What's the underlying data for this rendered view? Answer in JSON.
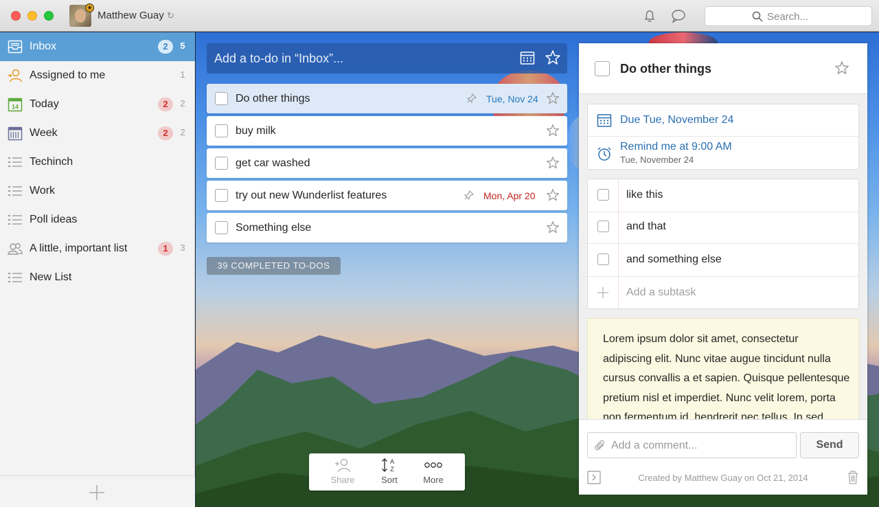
{
  "titlebar": {
    "username": "Matthew Guay",
    "search_placeholder": "Search..."
  },
  "sidebar": {
    "items": [
      {
        "label": "Inbox",
        "overdue": "2",
        "count": "5",
        "icon": "inbox-icon"
      },
      {
        "label": "Assigned to me",
        "overdue": "",
        "count": "1",
        "icon": "assigned-icon"
      },
      {
        "label": "Today",
        "overdue": "2",
        "count": "2",
        "icon": "calendar-today-icon",
        "day": "14"
      },
      {
        "label": "Week",
        "overdue": "2",
        "count": "2",
        "icon": "calendar-week-icon"
      },
      {
        "label": "Techinch",
        "overdue": "",
        "count": "",
        "icon": "list-icon"
      },
      {
        "label": "Work",
        "overdue": "",
        "count": "",
        "icon": "list-icon"
      },
      {
        "label": "Poll ideas",
        "overdue": "",
        "count": "",
        "icon": "list-icon"
      },
      {
        "label": "A little, important list",
        "overdue": "1",
        "count": "3",
        "icon": "shared-list-icon"
      },
      {
        "label": "New List",
        "overdue": "",
        "count": "",
        "icon": "list-icon"
      }
    ]
  },
  "main": {
    "add_placeholder": "Add a to-do in “Inbox”...",
    "todos": [
      {
        "title": "Do other things",
        "date": "Tue, Nov 24",
        "date_color": "#2a7ac0",
        "pinned": true,
        "selected": true
      },
      {
        "title": "buy milk",
        "date": "",
        "pinned": false,
        "selected": false
      },
      {
        "title": "get car washed",
        "date": "",
        "pinned": false,
        "selected": false
      },
      {
        "title": "try out new Wunderlist features",
        "date": "Mon, Apr 20",
        "date_color": "#c0251b",
        "pinned": true,
        "selected": false
      },
      {
        "title": "Something else",
        "date": "",
        "pinned": false,
        "selected": false
      }
    ],
    "completed_label": "39 COMPLETED TO-DOS",
    "toolbar": {
      "share": "Share",
      "sort": "Sort",
      "more": "More"
    }
  },
  "detail": {
    "title": "Do other things",
    "due": "Due Tue, November 24",
    "remind": "Remind me at 9:00 AM",
    "remind_date": "Tue, November 24",
    "subtasks": [
      "like this",
      "and that",
      "and something else"
    ],
    "add_subtask": "Add a subtask",
    "note": "Lorem ipsum dolor sit amet, consectetur adipiscing elit. Nunc vitae augue tincidunt nulla cursus convallis a et sapien. Quisque pellentesque pretium nisl et imperdiet. Nunc velit lorem, porta non fermentum id, hendrerit nec tellus. In sed",
    "comment_placeholder": "Add a comment...",
    "send_label": "Send",
    "created": "Created by Matthew Guay on Oct 21, 2014"
  },
  "colors": {
    "accent": "#5a9fd6",
    "overdue": "#d0302b",
    "due": "#2a6fb0"
  }
}
